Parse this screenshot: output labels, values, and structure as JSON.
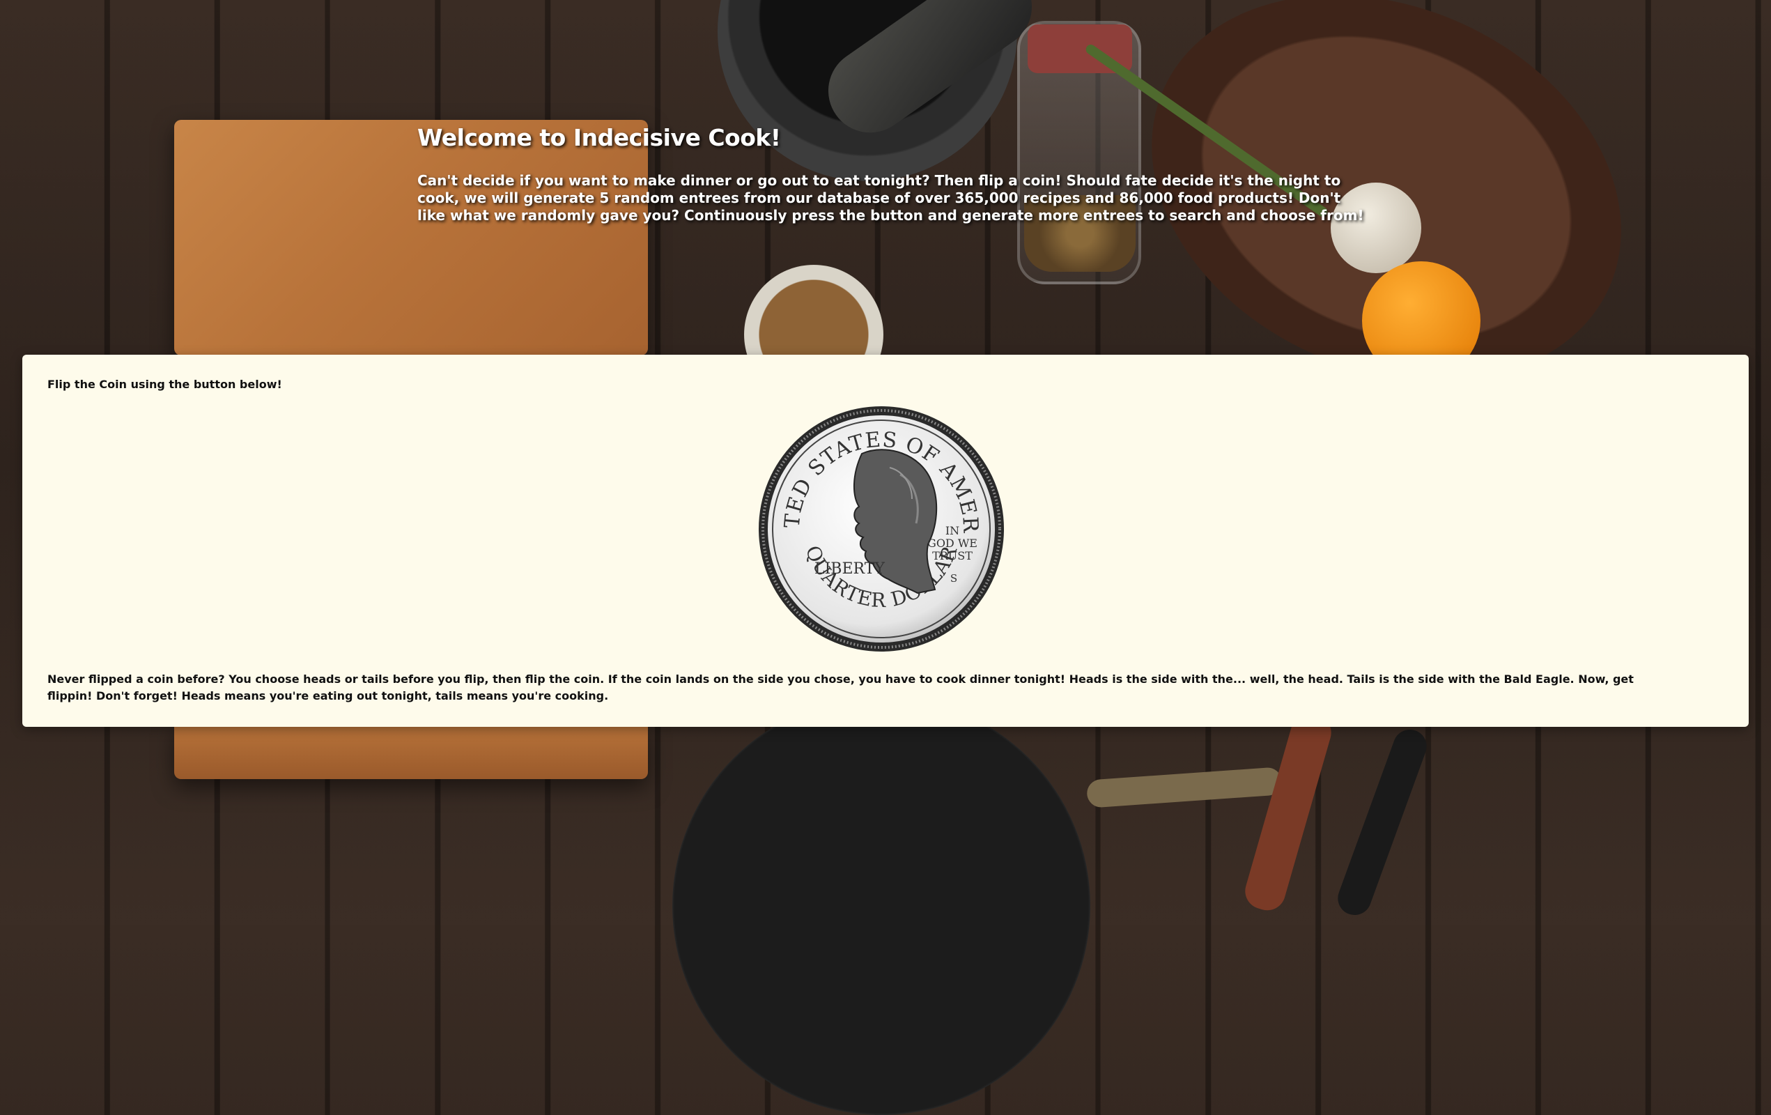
{
  "header": {
    "title": "Welcome to Indecisive Cook!",
    "description": "Can't decide if you want to make dinner or go out to eat tonight? Then flip a coin! Should fate decide it's the night to cook, we will generate 5 random entrees from our database of over 365,000 recipes and 86,000 food products! Don't like what we randomly gave you? Continuously press the button and generate more entrees to search and choose from!"
  },
  "card": {
    "intro": "Flip the Coin using the button below!",
    "coin": {
      "icon": "quarter-coin-icon",
      "top_text": "UNITED STATES OF AMERICA",
      "bottom_text": "QUARTER DOLLAR",
      "left_text": "LIBERTY",
      "motto_line1": "IN",
      "motto_line2": "GOD WE",
      "motto_line3": "TRUST",
      "mint_mark": "S"
    },
    "rules": "Never flipped a coin before? You choose heads or tails before you flip, then flip the coin. If the coin lands on the side you chose, you have to cook dinner tonight! Heads is the side with the... well, the head. Tails is the side with the Bald Eagle. Now, get flippin! Don't forget! Heads means you're eating out tonight, tails means you're cooking."
  },
  "colors": {
    "card_background": "#fefbeb",
    "heading_text": "#ffffff",
    "body_text": "#111111"
  }
}
